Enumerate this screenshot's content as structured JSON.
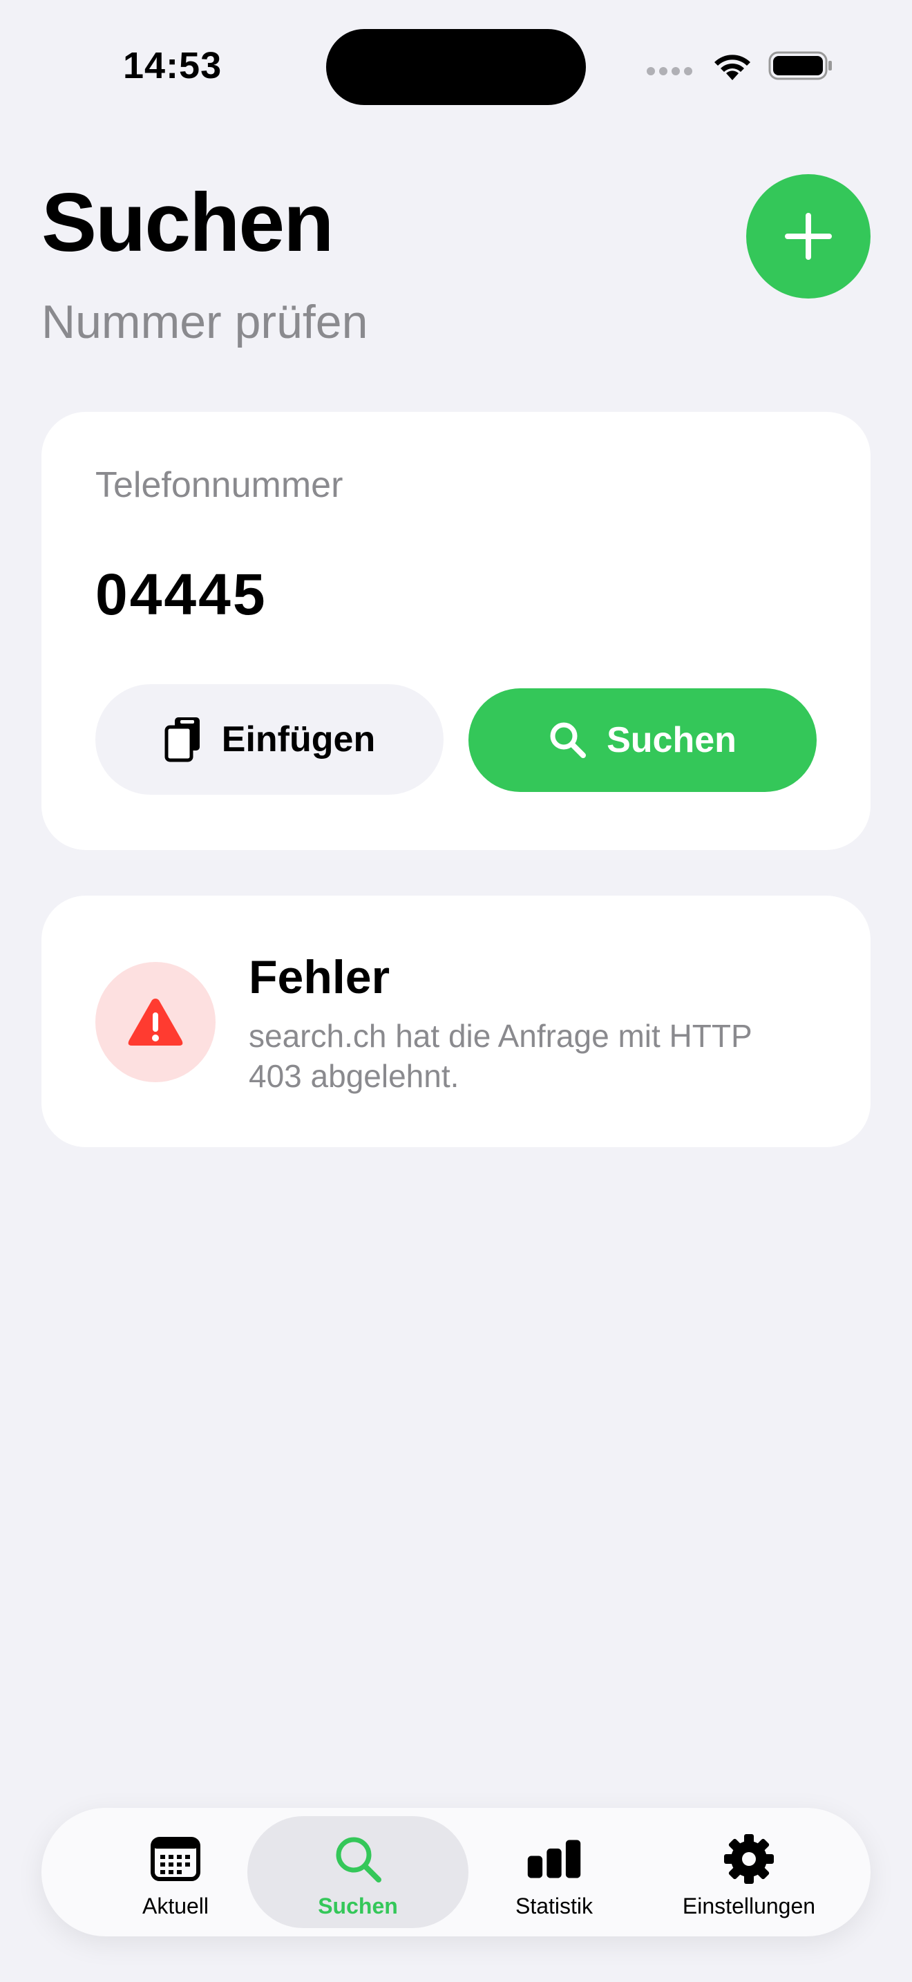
{
  "status_bar": {
    "time": "14:53"
  },
  "header": {
    "title": "Suchen",
    "subtitle": "Nummer prüfen",
    "add_icon": "plus-icon"
  },
  "search_card": {
    "field_label": "Telefonnummer",
    "field_value": "04445",
    "paste_label": "Einfügen",
    "paste_icon": "clipboard-icon",
    "search_label": "Suchen",
    "search_icon": "magnifier-icon"
  },
  "error_card": {
    "icon": "warning-triangle-icon",
    "title": "Fehler",
    "message": "search.ch hat die Anfrage mit HTTP 403 abgelehnt."
  },
  "tab_bar": {
    "tabs": [
      {
        "label": "Aktuell",
        "icon": "calendar-icon",
        "active": false
      },
      {
        "label": "Suchen",
        "icon": "search-icon",
        "active": true
      },
      {
        "label": "Statistik",
        "icon": "bar-chart-icon",
        "active": false
      },
      {
        "label": "Einstellungen",
        "icon": "gear-icon",
        "active": false
      }
    ]
  },
  "colors": {
    "accent": "#34c759",
    "background": "#f2f2f7",
    "error": "#ff3b30",
    "error_background": "#fde0e0",
    "secondary_text": "#8a8a8e"
  }
}
